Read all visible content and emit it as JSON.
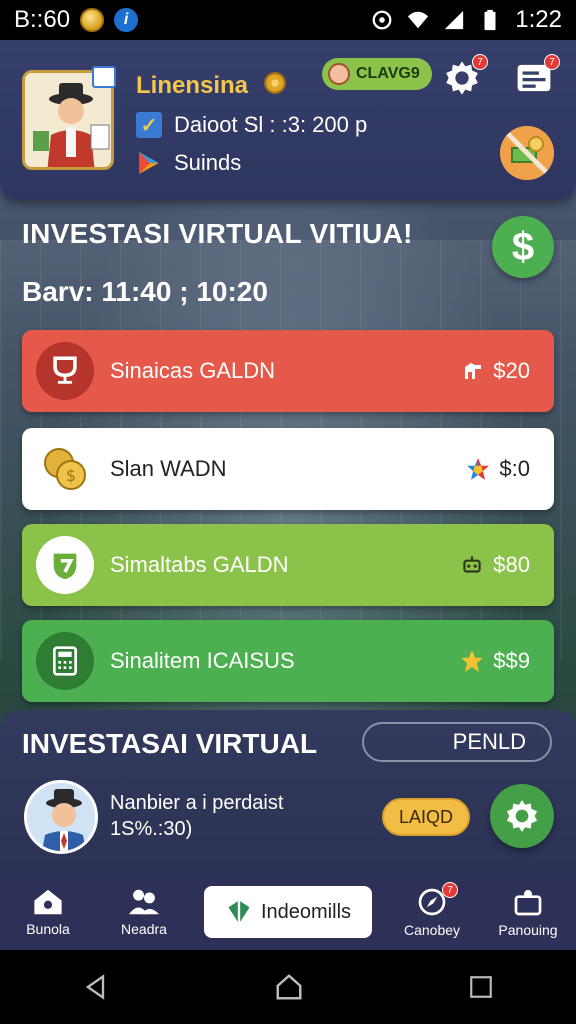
{
  "status_bar": {
    "left_text": "B::60",
    "time": "1:22",
    "icons": [
      "coin-icon",
      "info-icon",
      "alarm-icon",
      "wifi-icon",
      "signal-icon",
      "battery-icon"
    ]
  },
  "header": {
    "username": "Linensina",
    "tag_label": "CLAVG9",
    "info_line": "Daioot Sl : :3: 200 p",
    "sounds_label": "Suinds",
    "settings_badge": "7",
    "messages_badge": "7"
  },
  "section": {
    "title": "INVESTASI VIRTUAL VITIUA!",
    "timer": "Barv: 11:40 ; 10:20"
  },
  "cards": [
    {
      "label": "Sinaicas GALDN",
      "value": "$20",
      "icon": "trophy-icon",
      "right_icon": "horse-icon",
      "color": "#e4594a"
    },
    {
      "label": "Slan WADN",
      "value": "$:0",
      "icon": "coins-icon",
      "right_icon": "star-multicolor-icon",
      "color": "#ffffff"
    },
    {
      "label": "Simaltabs GALDN",
      "value": "$80",
      "icon": "leaf-shield-icon",
      "right_icon": "robot-icon",
      "color": "#8bc34a"
    },
    {
      "label": "Sinalitem ICAISUS",
      "value": "$$9",
      "icon": "calculator-icon",
      "right_icon": "star-icon",
      "color": "#4caf50"
    }
  ],
  "bottom_panel": {
    "title": "INVESTASAI VIRTUAL",
    "pending_label": "PENLD",
    "line1": "Nanbier a i perdaist",
    "line2": "1S%.:30)",
    "load_label": "LAIQD"
  },
  "nav": {
    "items": [
      {
        "label": "Bunola",
        "icon": "home-icon"
      },
      {
        "label": "Neadra",
        "icon": "people-icon"
      },
      {
        "label": "Indeomills",
        "icon": "leaf-icon"
      },
      {
        "label": "Canobey",
        "icon": "compass-icon",
        "badge": "7"
      },
      {
        "label": "Panouing",
        "icon": "profile-icon"
      }
    ]
  },
  "colors": {
    "header_bg": "#363f6a",
    "gold": "#f4c64a",
    "green": "#4caf50",
    "red": "#e4594a",
    "lime": "#8bc34a"
  }
}
